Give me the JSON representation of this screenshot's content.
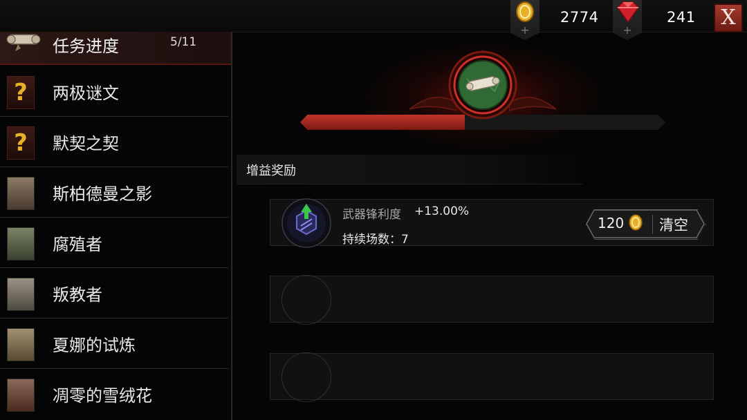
{
  "currency": {
    "gold": {
      "icon": "gold-coin-icon",
      "value": "2774"
    },
    "gems": {
      "icon": "red-gem-icon",
      "value": "241"
    },
    "close_label": "X"
  },
  "quest_list": {
    "header": {
      "title": "任务进度",
      "progress": "5/11",
      "icon": "scroll-icon"
    },
    "items": [
      {
        "label": "两极谜文",
        "icon": "question-mark-icon"
      },
      {
        "label": "默契之契",
        "icon": "question-mark-icon"
      },
      {
        "label": "斯柏德曼之影",
        "icon": "portrait-icon"
      },
      {
        "label": "腐殖者",
        "icon": "portrait-icon"
      },
      {
        "label": "叛教者",
        "icon": "portrait-icon"
      },
      {
        "label": "夏娜的试炼",
        "icon": "portrait-icon"
      },
      {
        "label": "凋零的雪绒花",
        "icon": "portrait-icon"
      }
    ]
  },
  "progress": {
    "fraction": 0.45,
    "emblem": "scroll-emblem-icon"
  },
  "buffs": {
    "section_title": "增益奖励",
    "active": {
      "name": "武器锋利度",
      "value": "+13.00%",
      "duration": "持续场数：7",
      "icon": "weapon-sharpness-icon",
      "clear_cost": "120",
      "clear_label": "清空"
    },
    "empty_slots": 2
  },
  "colors": {
    "accent_red": "#c2342a",
    "gold": "#e8b028",
    "gem": "#d0202a"
  }
}
